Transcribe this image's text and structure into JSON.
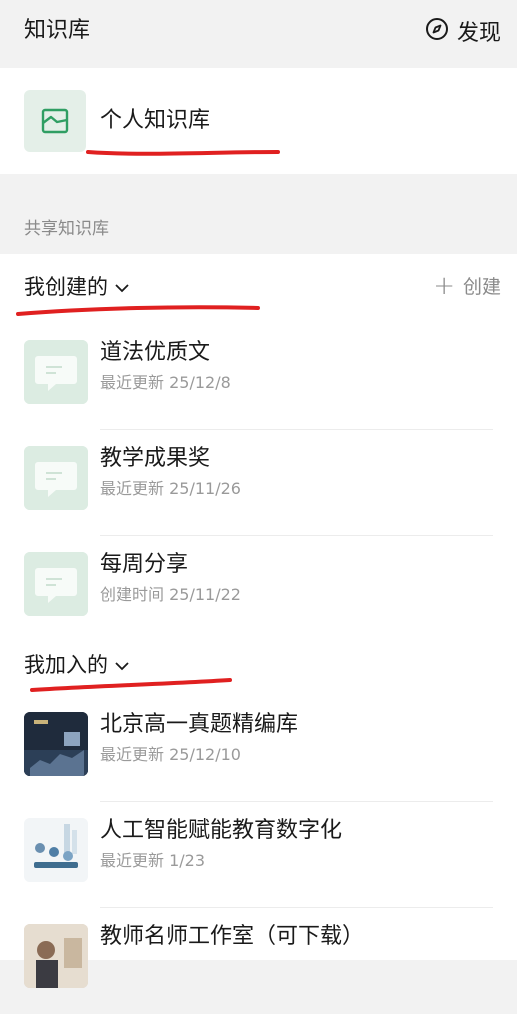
{
  "header": {
    "title": "知识库",
    "discover_label": "发现",
    "discover_icon": "compass-icon"
  },
  "personal": {
    "label": "个人知识库",
    "icon": "image-frame-icon"
  },
  "shared": {
    "section_title": "共享知识库"
  },
  "created": {
    "heading": "我创建的",
    "create_label": "创建",
    "items": [
      {
        "name": "道法优质文",
        "sub": "最近更新 25/12/8"
      },
      {
        "name": "教学成果奖",
        "sub": "最近更新 25/11/26"
      },
      {
        "name": "每周分享",
        "sub": "创建时间 25/11/22"
      }
    ]
  },
  "joined": {
    "heading": "我加入的",
    "items": [
      {
        "name": "北京高一真题精编库",
        "sub": "最近更新 25/12/10"
      },
      {
        "name": "人工智能赋能教育数字化",
        "sub": "最近更新 1/23"
      },
      {
        "name": "教师名师工作室（可下载）",
        "sub": ""
      }
    ]
  },
  "colors": {
    "accent_green": "#2f9e63",
    "annotation_red": "#e02020",
    "muted_text": "#9a9a9a"
  }
}
